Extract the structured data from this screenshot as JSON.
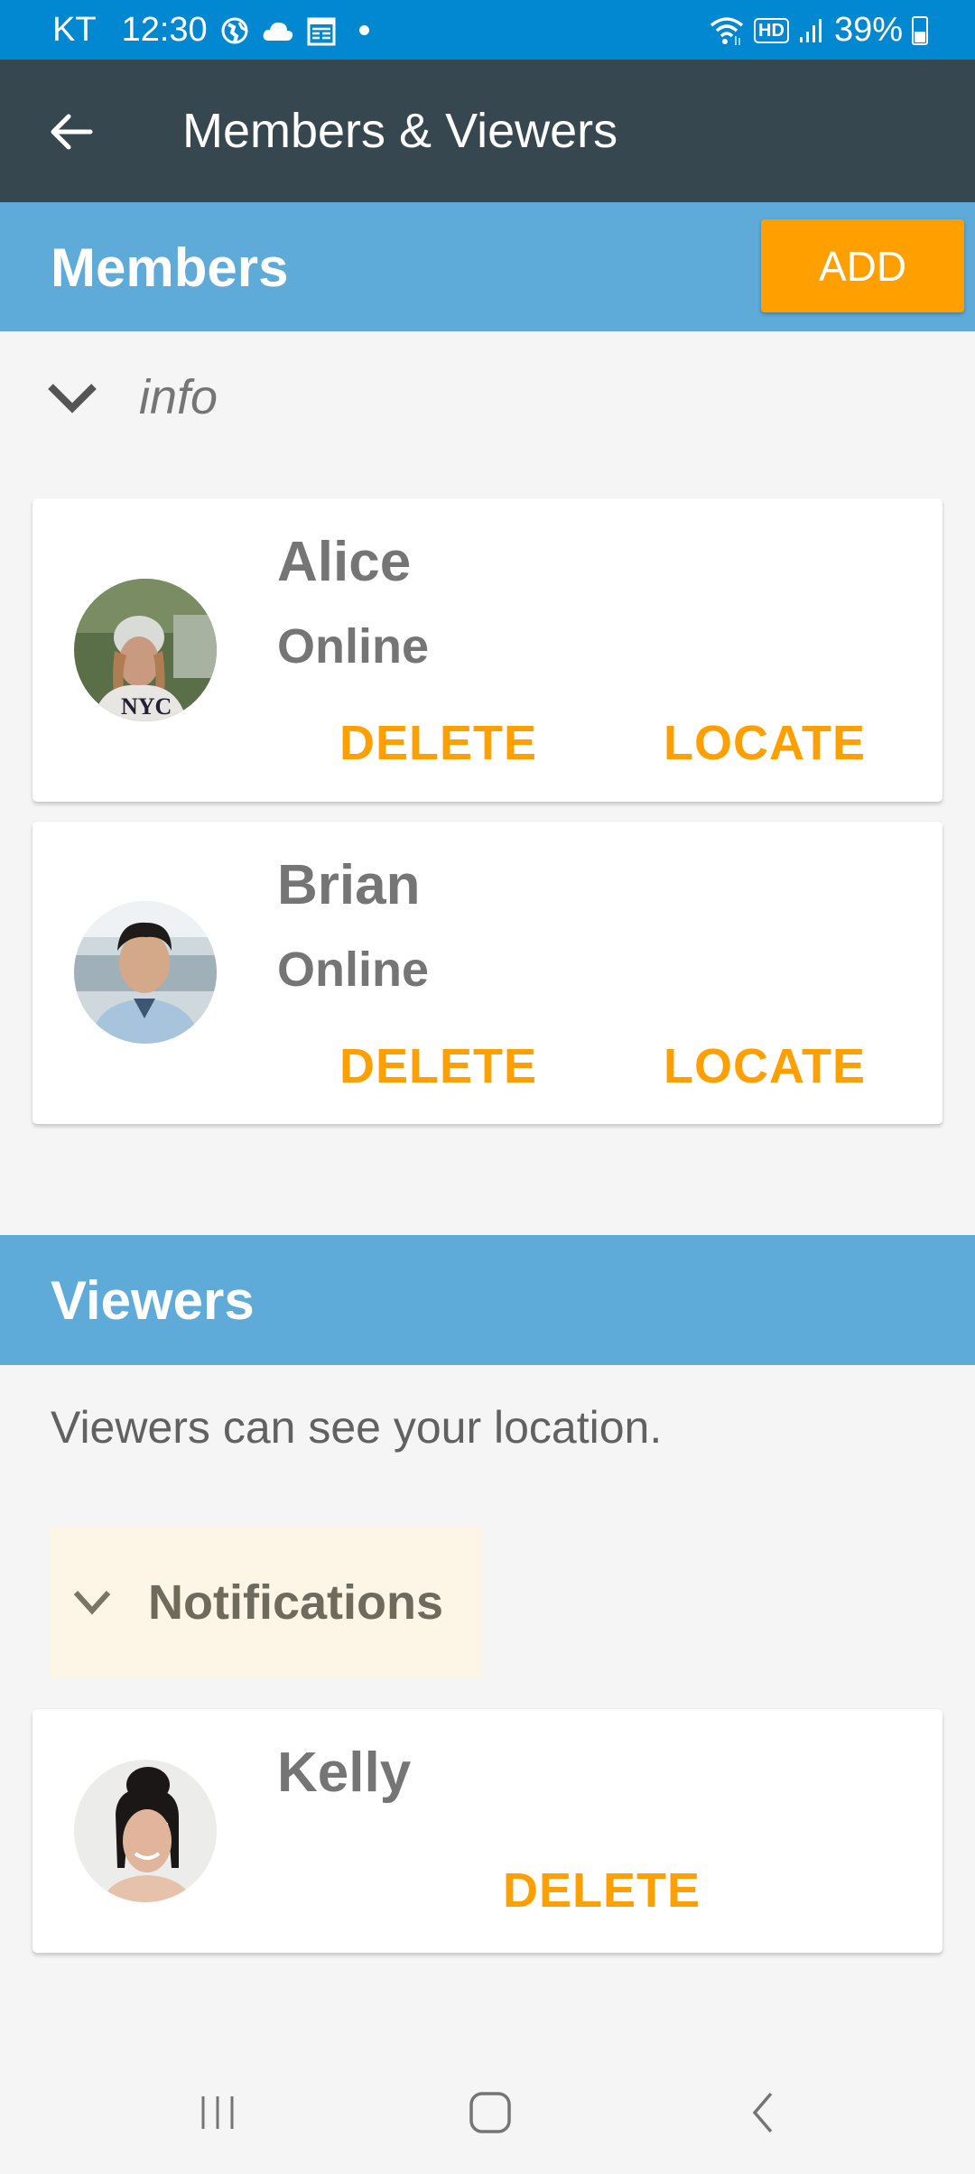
{
  "status_bar": {
    "carrier": "KT",
    "time": "12:30",
    "left_icons": [
      "globe-icon",
      "cloud-icon",
      "calendar-icon",
      "notification-dot-icon"
    ],
    "right_icons": [
      "wifi-icon",
      "hd-voice-icon",
      "signal-icon"
    ],
    "hd_label": "HD",
    "battery_percent": "39%"
  },
  "app_bar": {
    "back_icon": "arrow-left-icon",
    "title": "Members & Viewers"
  },
  "members": {
    "title": "Members",
    "add_label": "ADD",
    "info_toggle": {
      "icon": "chevron-down-icon",
      "label": "info"
    },
    "items": [
      {
        "name": "Alice",
        "status": "Online",
        "delete_label": "DELETE",
        "locate_label": "LOCATE"
      },
      {
        "name": "Brian",
        "status": "Online",
        "delete_label": "DELETE",
        "locate_label": "LOCATE"
      }
    ]
  },
  "viewers": {
    "title": "Viewers",
    "description": "Viewers can see your location.",
    "notifications_toggle": {
      "icon": "chevron-down-icon",
      "label": "Notifications"
    },
    "items": [
      {
        "name": "Kelly",
        "delete_label": "DELETE"
      }
    ]
  },
  "nav_bar": {
    "recents_icon": "recents-icon",
    "home_icon": "home-icon",
    "back_icon": "back-icon"
  },
  "colors": {
    "status_bar": "#0288d1",
    "app_bar": "#37474f",
    "section_header": "#5eaad8",
    "accent": "#ffa000",
    "notifications_bg": "#fdf6e7"
  }
}
